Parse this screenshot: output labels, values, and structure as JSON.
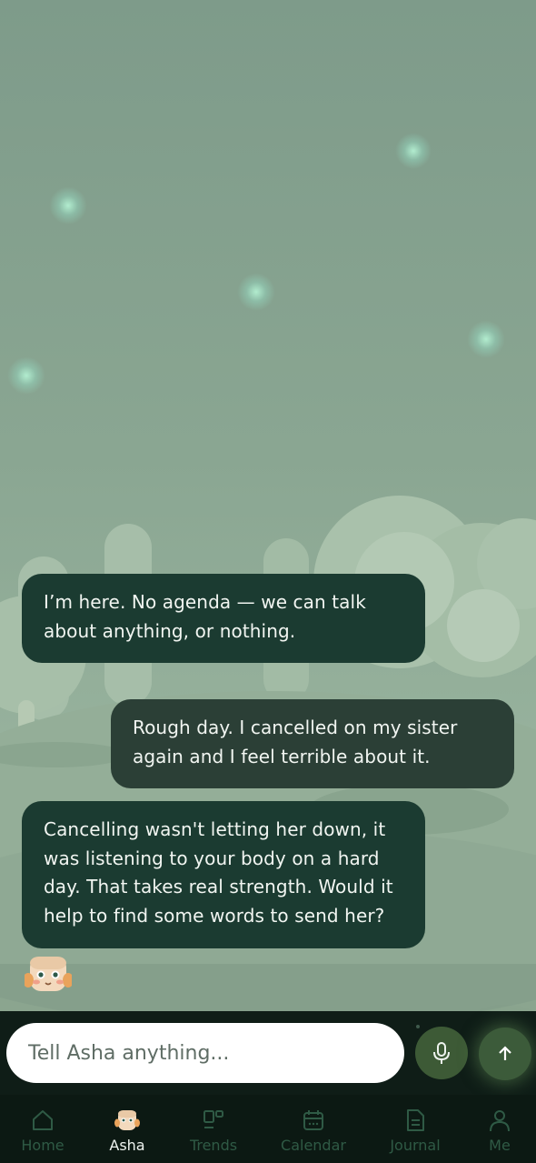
{
  "messages": [
    {
      "role": "assistant",
      "text": "I’m here. No agenda — we can talk about anything, or nothing."
    },
    {
      "role": "user",
      "text": "Rough day. I cancelled on my sister again and I feel terrible about it."
    },
    {
      "role": "assistant",
      "text": "Cancelling wasn't letting her down, it was listening to your body on a hard day. That takes real strength. Would it help to find some words to send her?"
    }
  ],
  "composer": {
    "placeholder": "Tell Asha anything..."
  },
  "nav": {
    "items": [
      {
        "label": "Home",
        "icon": "home-icon",
        "active": false
      },
      {
        "label": "Asha",
        "icon": "asha-avatar-icon",
        "active": true
      },
      {
        "label": "Trends",
        "icon": "trends-icon",
        "active": false
      },
      {
        "label": "Calendar",
        "icon": "calendar-icon",
        "active": false
      },
      {
        "label": "Journal",
        "icon": "journal-icon",
        "active": false
      },
      {
        "label": "Me",
        "icon": "person-icon",
        "active": false
      }
    ]
  },
  "colors": {
    "bubble_assistant": "#1b3b31",
    "bubble_user": "#2b3f36",
    "accent": "#3e5e3c",
    "nav_active": "#eef3ef",
    "nav_inactive": "#2f5a45"
  }
}
